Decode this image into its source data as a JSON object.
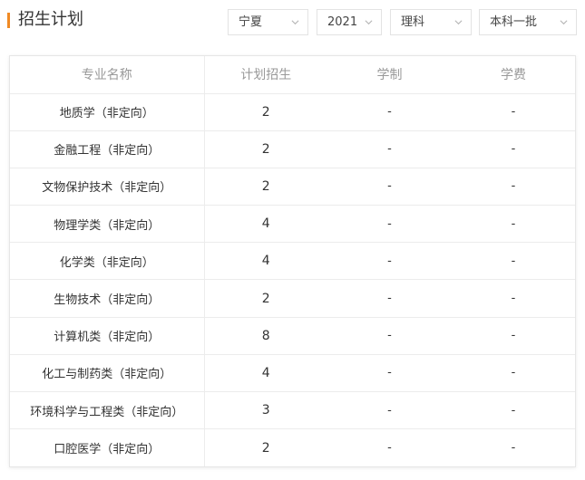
{
  "header": {
    "title": "招生计划",
    "accent_color": "#f08a24"
  },
  "filters": {
    "province": "宁夏",
    "year": "2021",
    "subject": "理科",
    "batch": "本科一批",
    "chevron_icon": "chevron-down-icon"
  },
  "table": {
    "columns": [
      "专业名称",
      "计划招生",
      "学制",
      "学费"
    ],
    "rows": [
      {
        "major": "地质学（非定向）",
        "plan": "2",
        "duration": "-",
        "fee": "-"
      },
      {
        "major": "金融工程（非定向）",
        "plan": "2",
        "duration": "-",
        "fee": "-"
      },
      {
        "major": "文物保护技术（非定向）",
        "plan": "2",
        "duration": "-",
        "fee": "-"
      },
      {
        "major": "物理学类（非定向）",
        "plan": "4",
        "duration": "-",
        "fee": "-"
      },
      {
        "major": "化学类（非定向）",
        "plan": "4",
        "duration": "-",
        "fee": "-"
      },
      {
        "major": "生物技术（非定向）",
        "plan": "2",
        "duration": "-",
        "fee": "-"
      },
      {
        "major": "计算机类（非定向）",
        "plan": "8",
        "duration": "-",
        "fee": "-"
      },
      {
        "major": "化工与制药类（非定向）",
        "plan": "4",
        "duration": "-",
        "fee": "-"
      },
      {
        "major": "环境科学与工程类（非定向）",
        "plan": "3",
        "duration": "-",
        "fee": "-"
      },
      {
        "major": "口腔医学（非定向）",
        "plan": "2",
        "duration": "-",
        "fee": "-"
      }
    ]
  }
}
